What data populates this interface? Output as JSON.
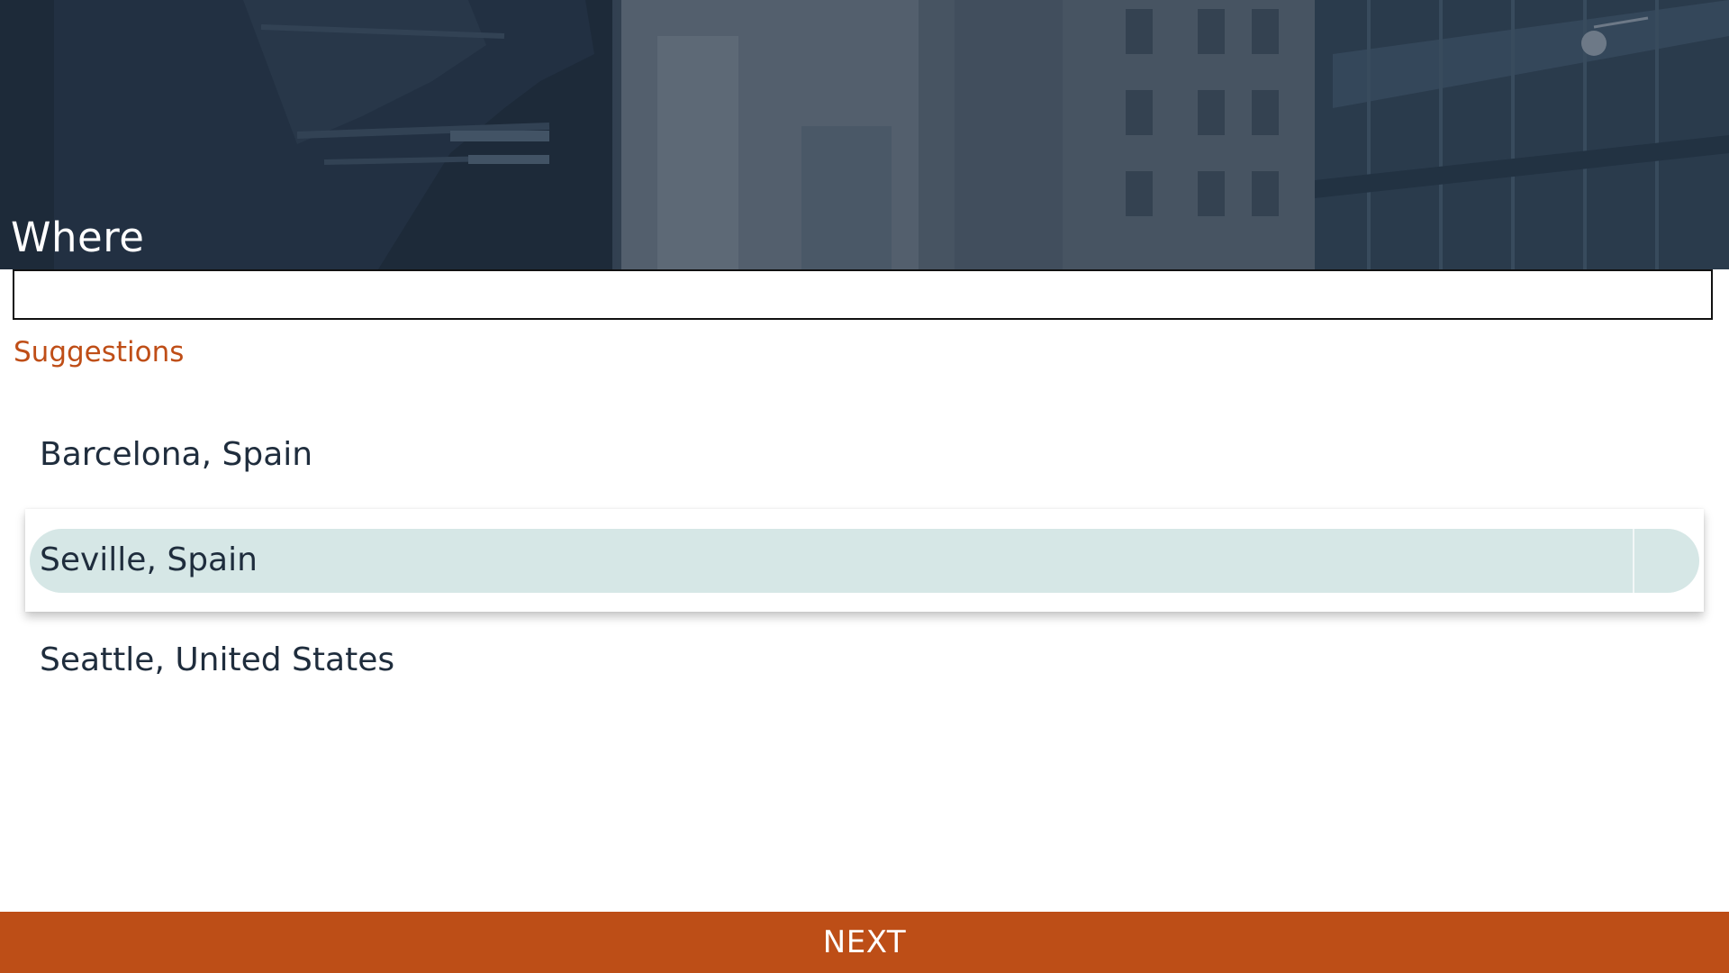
{
  "hero": {
    "title": "Where"
  },
  "search": {
    "value": "",
    "placeholder": ""
  },
  "suggestions": {
    "heading": "Suggestions",
    "items": [
      {
        "label": "Barcelona, Spain",
        "highlighted": false
      },
      {
        "label": "Seville, Spain",
        "highlighted": true
      },
      {
        "label": "Seattle, United States",
        "highlighted": false
      }
    ]
  },
  "footer": {
    "next_label": "NEXT"
  },
  "colors": {
    "accent": "#bd4e17",
    "text": "#1f2d3d",
    "highlight": "#d6e7e6",
    "hero_overlay": "#23303f"
  }
}
